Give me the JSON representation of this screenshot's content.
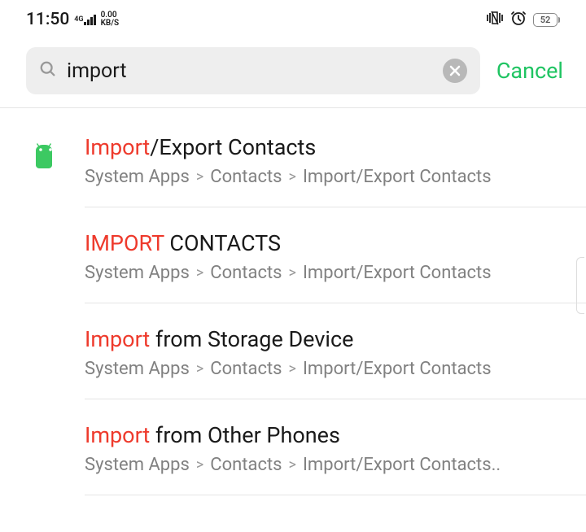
{
  "status": {
    "time": "11:50",
    "tag_4g": "4G",
    "data_top": "0.00",
    "data_bottom": "KB/S",
    "battery": "52"
  },
  "search": {
    "query": "import",
    "cancel": "Cancel"
  },
  "results": [
    {
      "title_hl": "Import",
      "title_rest": "/Export Contacts",
      "path": [
        "System Apps",
        "Contacts",
        "Import/Export Contacts"
      ],
      "show_icon": true
    },
    {
      "title_hl": "IMPORT",
      "title_rest": " CONTACTS",
      "path": [
        "System Apps",
        "Contacts",
        "Import/Export Contacts"
      ],
      "show_icon": false
    },
    {
      "title_hl": "Import",
      "title_rest": " from Storage Device",
      "path": [
        "System Apps",
        "Contacts",
        "Import/Export Contacts"
      ],
      "show_icon": false
    },
    {
      "title_hl": "Import",
      "title_rest": " from Other Phones",
      "path": [
        "System Apps",
        "Contacts",
        "Import/Export Contacts.."
      ],
      "show_icon": false
    }
  ]
}
